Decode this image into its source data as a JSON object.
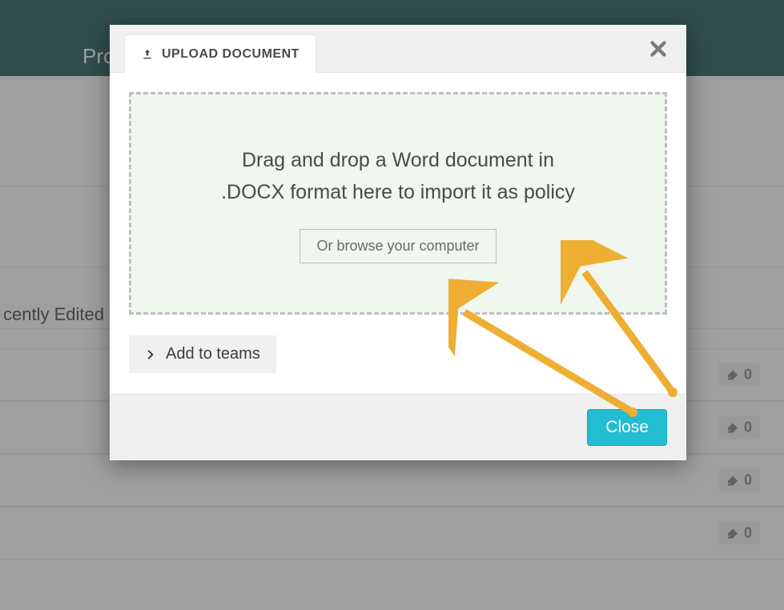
{
  "background": {
    "header_title_fragment": "Pro",
    "section_label_fragment": "cently Edited",
    "tag_counts": [
      0,
      0,
      0,
      0
    ]
  },
  "modal": {
    "tab_label": "UPLOAD DOCUMENT",
    "drop_message_line1": "Drag and drop a Word document in",
    "drop_message_line2": ".DOCX format here to import it as policy",
    "browse_label": "Or browse your computer",
    "add_teams_label": "Add to teams",
    "close_label": "Close"
  },
  "icons": {
    "upload": "upload-icon",
    "close_x": "close-icon",
    "chevron_right": "chevron-right-icon",
    "tag": "tag-icon"
  },
  "colors": {
    "header_bg": "#0b4a4a",
    "dropzone_bg": "#eff7ee",
    "primary_button": "#22bcd3",
    "arrow": "#eeae33"
  }
}
